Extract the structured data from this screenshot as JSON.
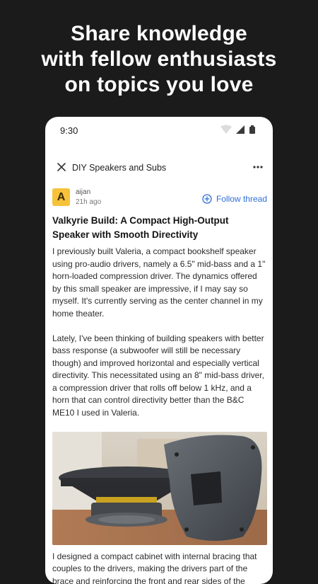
{
  "promo": {
    "headline_lines": [
      "Share knowledge",
      "with fellow enthusiasts",
      "on topics you love"
    ]
  },
  "status_bar": {
    "time": "9:30",
    "icons": [
      "wifi-icon",
      "signal-icon",
      "battery-icon"
    ]
  },
  "app_bar": {
    "close_icon": "close-icon",
    "title": "DIY Speakers and Subs",
    "more_icon": "more-icon"
  },
  "post": {
    "avatar_letter": "A",
    "avatar_color": "#f5c23a",
    "author": "aijan",
    "time_ago": "21h ago",
    "follow_label": "Follow thread",
    "follow_color": "#2f6fd6",
    "title": "Valkyrie Build: A Compact High-Output Speaker with Smooth Directivity",
    "paragraphs": [
      "I previously built Valeria, a compact bookshelf speaker using pro-audio drivers, namely a 6.5\" mid-bass and a 1\" horn-loaded compression driver. The dynamics offered by this small speaker are impressive, if I may say so myself. It's currently serving as the center channel in my home theater.",
      "Lately, I've been thinking of building speakers with better bass response (a subwoofer will still be necessary though) and improved horizontal and especially vertical directivity. This necessitated using an 8\" mid-bass driver, a compression driver that rolls off below 1 kHz, and a horn that can control directivity better than the B&C ME10 I used in Valeria."
    ],
    "after_image": "I designed a compact cabinet with internal bracing that couples to the drivers, making the drivers part of the brace and reinforcing the front and rear sides of the"
  }
}
